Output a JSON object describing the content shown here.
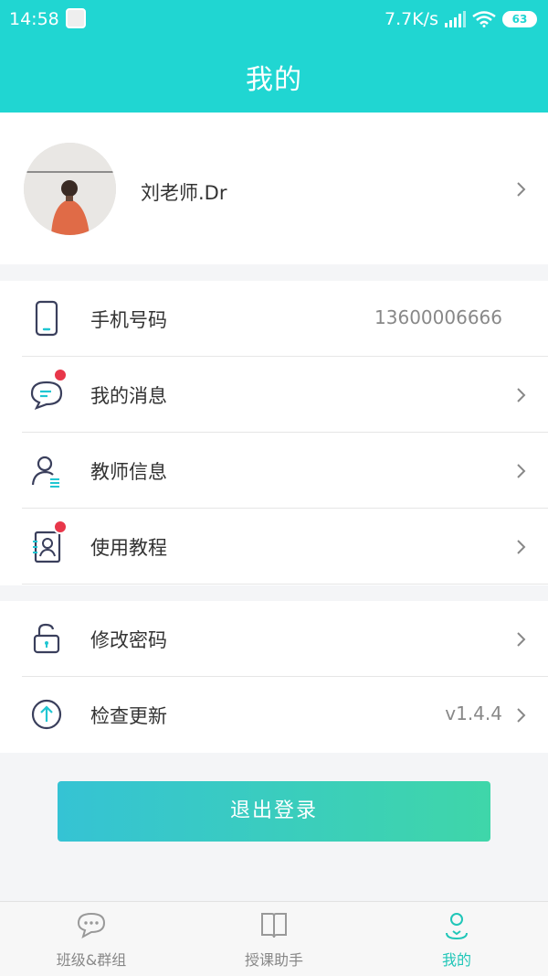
{
  "status_bar": {
    "time": "14:58",
    "network_speed": "7.7K/s",
    "battery": "63"
  },
  "header": {
    "title": "我的"
  },
  "profile": {
    "name": "刘老师.Dr"
  },
  "menu": {
    "phone": {
      "label": "手机号码",
      "value": "13600006666",
      "icon": "phone-icon"
    },
    "messages": {
      "label": "我的消息",
      "icon": "message-icon",
      "badge": true
    },
    "teacher_info": {
      "label": "教师信息",
      "icon": "teacher-icon"
    },
    "tutorial": {
      "label": "使用教程",
      "icon": "tutorial-icon",
      "badge": true
    },
    "password": {
      "label": "修改密码",
      "icon": "lock-icon"
    },
    "update": {
      "label": "检查更新",
      "value": "v1.4.4",
      "icon": "upload-icon"
    }
  },
  "logout_button": {
    "label": "退出登录"
  },
  "tabbar": {
    "tabs": [
      {
        "label": "班级&群组",
        "icon": "chat-icon",
        "active": false
      },
      {
        "label": "授课助手",
        "icon": "book-icon",
        "active": false
      },
      {
        "label": "我的",
        "icon": "person-icon",
        "active": true
      }
    ]
  },
  "colors": {
    "accent": "#20d6d2",
    "badge": "#e8374a",
    "active_tab": "#20c6b8"
  }
}
